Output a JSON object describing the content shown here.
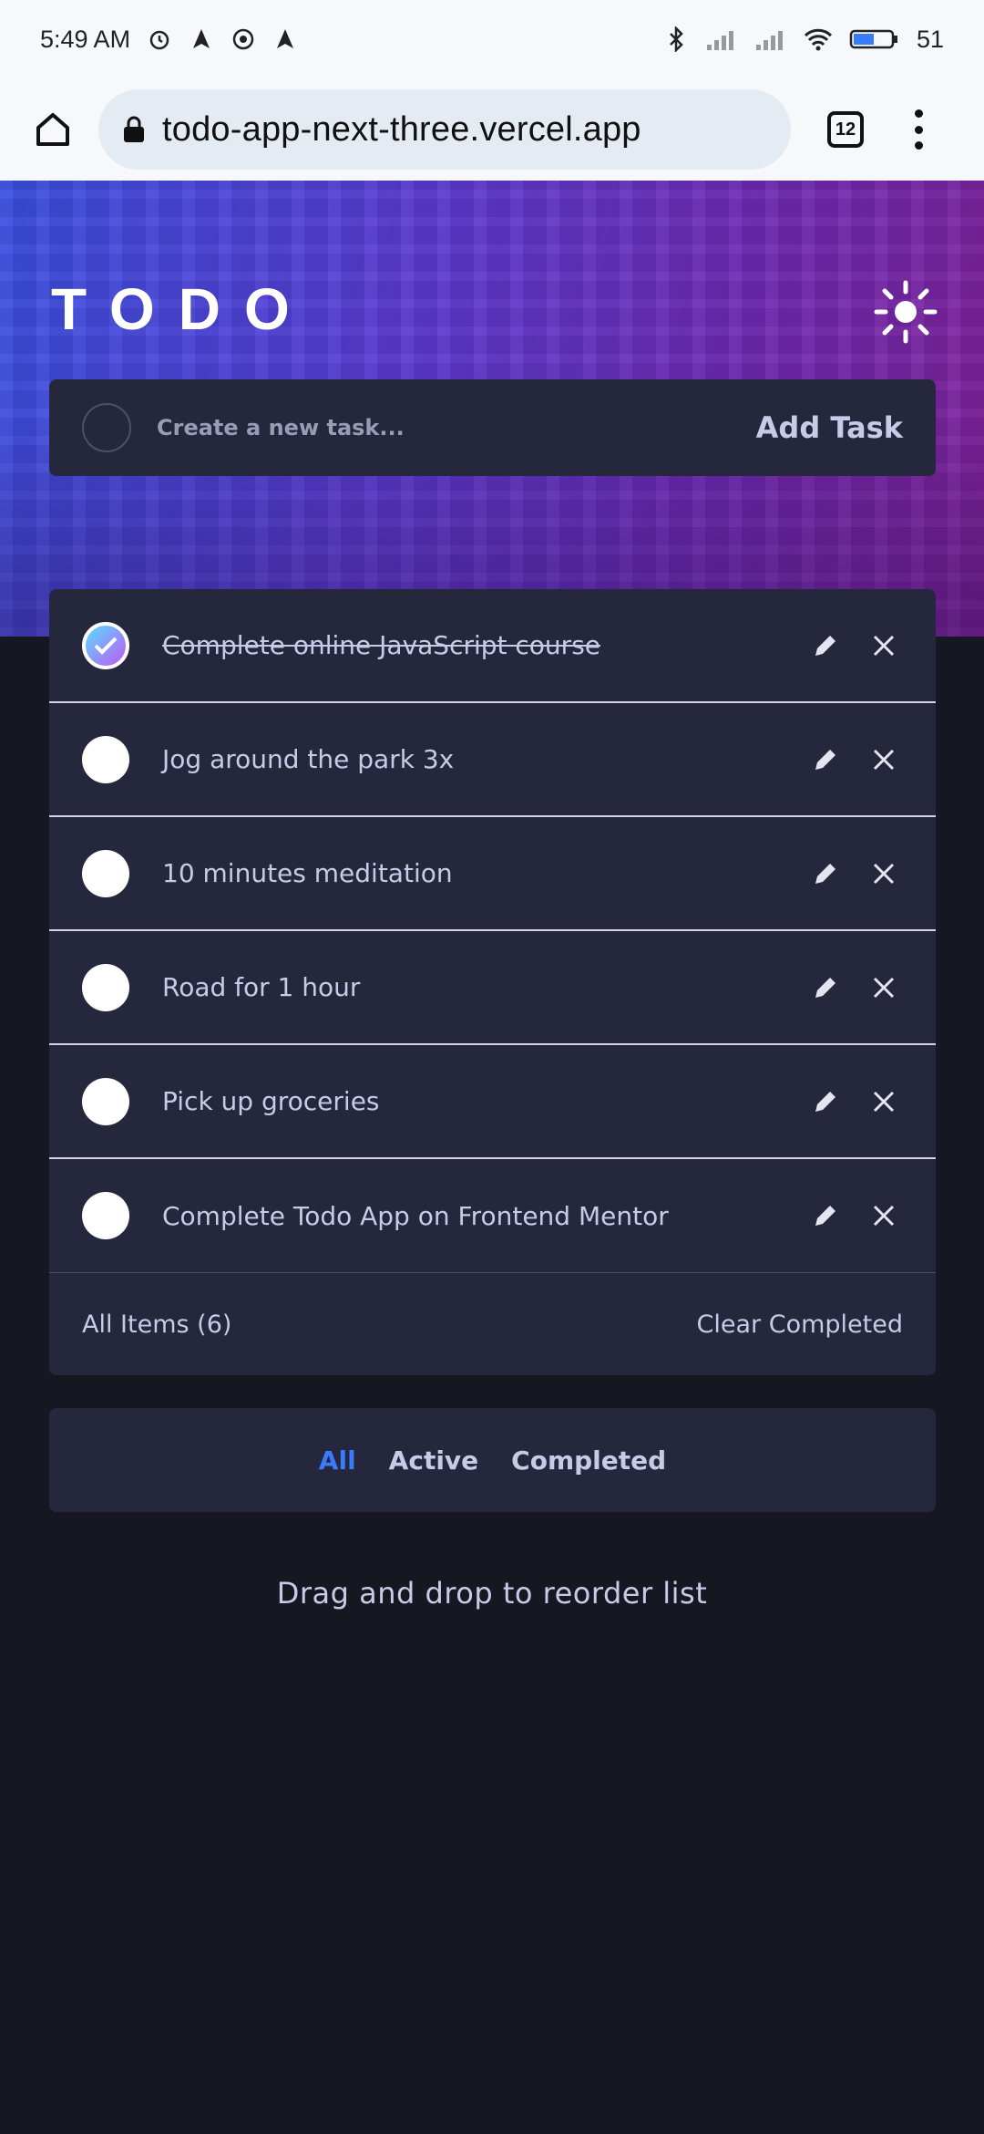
{
  "status_bar": {
    "time": "5:49 AM",
    "battery": "51"
  },
  "browser": {
    "url": "todo-app-next-three.vercel.app",
    "tab_count": "12"
  },
  "app": {
    "logo": "TODO",
    "new_task_placeholder": "Create a new task...",
    "add_task_label": "Add Task",
    "tasks": [
      {
        "text": "Complete online JavaScript course",
        "completed": true
      },
      {
        "text": "Jog around the park 3x",
        "completed": false
      },
      {
        "text": "10 minutes meditation",
        "completed": false
      },
      {
        "text": "Road for 1 hour",
        "completed": false
      },
      {
        "text": "Pick up groceries",
        "completed": false
      },
      {
        "text": "Complete Todo App on Frontend Mentor",
        "completed": false
      }
    ],
    "items_count_label": "All Items (6)",
    "clear_completed_label": "Clear Completed",
    "filters": {
      "all": "All",
      "active": "Active",
      "completed": "Completed"
    },
    "hint": "Drag and drop to reorder list"
  },
  "colors": {
    "accent": "#3a7bfd",
    "card": "#25273d",
    "background": "#171722"
  }
}
